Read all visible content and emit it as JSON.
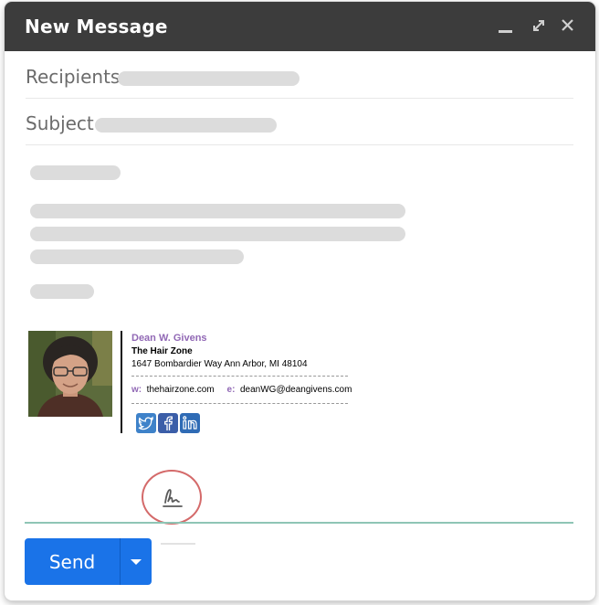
{
  "window": {
    "title": "New Message"
  },
  "titlebar_icons": [
    "minimize-icon",
    "expand-icon",
    "close-icon"
  ],
  "fields": {
    "recipients_label": "Recipients",
    "subject_label": "Subject"
  },
  "signature": {
    "name": "Dean W. Givens",
    "company": "The Hair Zone",
    "address": "1647 Bombardier Way Ann Arbor, MI 48104",
    "web_label": "w:",
    "web": "thehairzone.com",
    "email_label": "e:",
    "email": "deanWG@deangivens.com",
    "social_icons": [
      "twitter-icon",
      "facebook-icon",
      "linkedin-icon"
    ]
  },
  "toolbar": {
    "send_label": "Send",
    "signature_icon": "signature-icon"
  },
  "colors": {
    "titlebar": "#3c3c3c",
    "send_button": "#1a73e8",
    "signature_name": "#9168b5",
    "highlight_circle": "#d46a6a",
    "divider_green": "#8ec5b5"
  }
}
